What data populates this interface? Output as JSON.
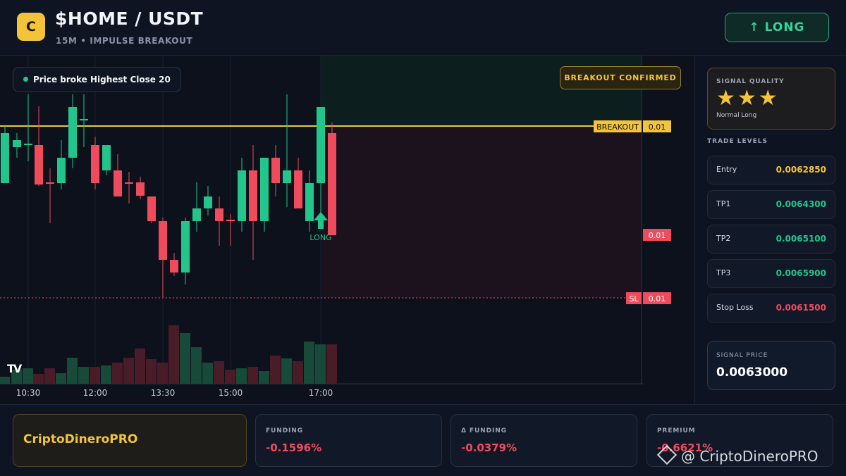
{
  "header": {
    "logo_letter": "C",
    "pair": "$HOME / USDT",
    "subtitle": "15M • IMPULSE BREAKOUT",
    "direction_button": "↑ LONG"
  },
  "chart": {
    "signal_pill": "Price broke Highest Close 20",
    "confirm_badge": "BREAKOUT CONFIRMED",
    "breakout_tag": "BREAKOUT",
    "breakout_price": "0.01",
    "entry_price_tag": "0.01",
    "sl_tag": "SL",
    "sl_price": "0.01",
    "long_marker": "LONG",
    "tv_logo": "TV",
    "x_labels": [
      "10:30",
      "12:00",
      "13:30",
      "15:00",
      "17:00"
    ],
    "colors": {
      "up": "#22c58b",
      "down": "#f04b5c",
      "breakout": "#f3c43a"
    }
  },
  "sidebar": {
    "quality_label": "SIGNAL QUALITY",
    "stars": "★★★",
    "quality_text": "Normal Long",
    "levels_title": "TRADE LEVELS",
    "levels": [
      {
        "name": "Entry",
        "value": "0.0062850",
        "color": "#f3c43a"
      },
      {
        "name": "TP1",
        "value": "0.0064300",
        "color": "#22c58b"
      },
      {
        "name": "TP2",
        "value": "0.0065100",
        "color": "#22c58b"
      },
      {
        "name": "TP3",
        "value": "0.0065900",
        "color": "#22c58b"
      },
      {
        "name": "Stop Loss",
        "value": "0.0061500",
        "color": "#f04b5c"
      }
    ],
    "signal_price_label": "SIGNAL PRICE",
    "signal_price": "0.0063000"
  },
  "footer": {
    "brand": "CriptoDineroPRO",
    "metrics": [
      {
        "label": "FUNDING",
        "value": "-0.1596%"
      },
      {
        "label": "Δ FUNDING",
        "value": "-0.0379%"
      },
      {
        "label": "PREMIUM",
        "value": "-0.6621%"
      }
    ],
    "watermark": "@ CriptoDineroPRO"
  }
}
